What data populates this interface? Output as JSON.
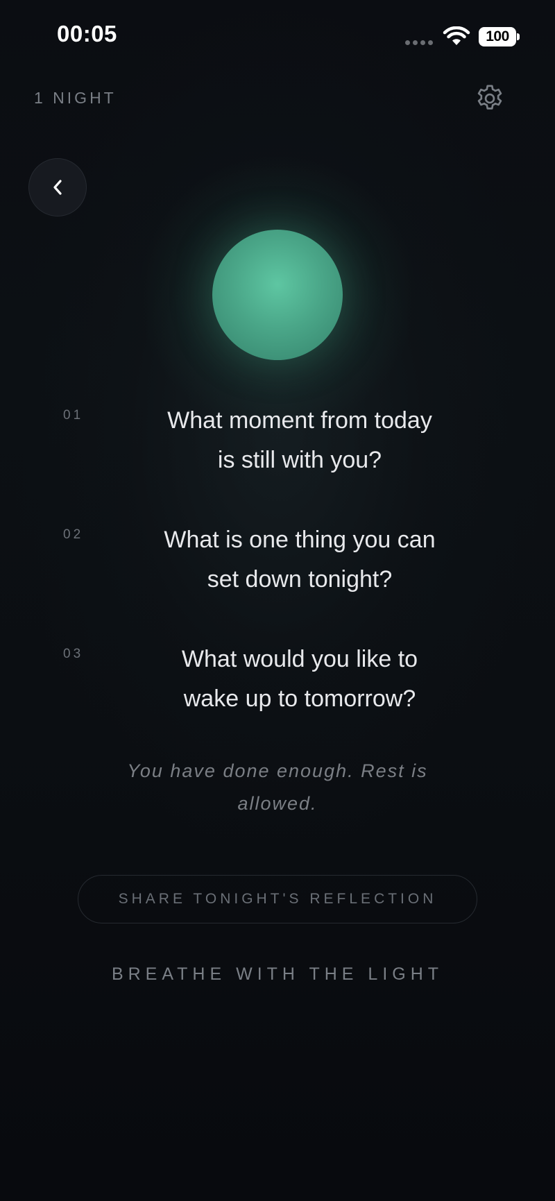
{
  "status_bar": {
    "time": "00:05",
    "battery": "100"
  },
  "header": {
    "nights_label": "1 NIGHT"
  },
  "prompts": [
    {
      "number": "01",
      "line1": "What moment from today",
      "line2": "is still with you?"
    },
    {
      "number": "02",
      "line1": "What is one thing you can",
      "line2": "set down tonight?"
    },
    {
      "number": "03",
      "line1": "What would you like to",
      "line2": "wake up to tomorrow?"
    }
  ],
  "affirmation": {
    "line1": "You have done enough. Rest is",
    "line2": "allowed."
  },
  "actions": {
    "share_label": "SHARE TONIGHT'S REFLECTION",
    "breathe_label": "BREATHE WITH THE LIGHT"
  },
  "icons": {
    "settings": "gear-icon",
    "back": "chevron-left-icon",
    "wifi": "wifi-icon",
    "signal": "signal-dots-icon"
  },
  "colors": {
    "orb": "#4aa688",
    "background": "#0a0c10",
    "text_primary": "#e8e9ec",
    "text_muted": "#7a7f86"
  }
}
